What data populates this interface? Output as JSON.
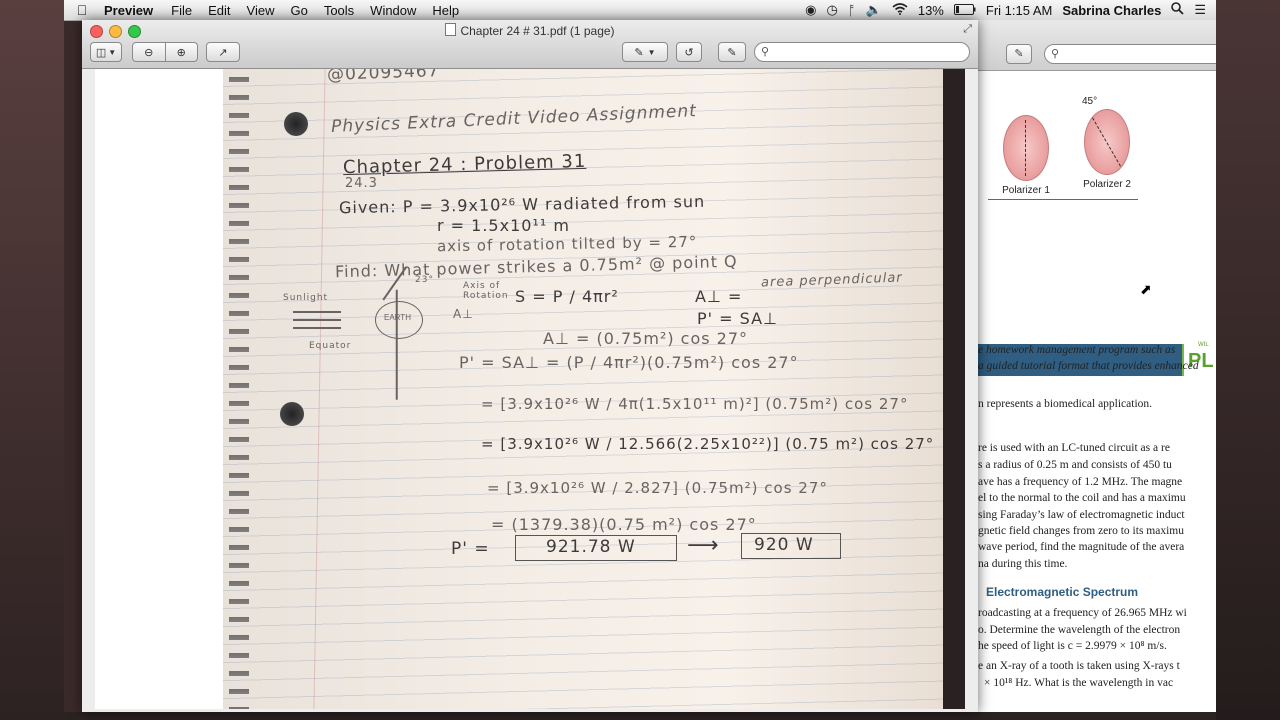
{
  "menubar": {
    "apple": "",
    "app_name": "Preview",
    "menus": [
      "File",
      "Edit",
      "View",
      "Go",
      "Tools",
      "Window",
      "Help"
    ],
    "battery": "13%",
    "clock": "Fri 1:15 AM",
    "user": "Sabrina Charles"
  },
  "window": {
    "title": "Chapter 24 # 31.pdf (1 page)",
    "search_placeholder": ""
  },
  "notes": {
    "id_line": "@02095467",
    "header": "Physics Extra Credit Video Assignment",
    "chapter": "Chapter 24 : Problem 31",
    "section": "24.3",
    "given_1": "Given: P = 3.9x10²⁶ W radiated from sun",
    "given_2": "r = 1.5x10¹¹ m",
    "given_3": "axis of rotation tilted by = 27°",
    "find": "Find: What power strikes a 0.75m² @ point Q",
    "axis_label": "Axis of Rotation",
    "sunlight_label": "Sunlight",
    "earth_label": "EARTH",
    "equator_label": "Equator",
    "angle_label": "23°",
    "area_perp": "area perpendicular",
    "s_formula": "S = P / 4πr²",
    "a_perp": "A⊥ =",
    "p_prime": "P' = SA⊥",
    "a_perp_val": "A⊥ = (0.75m²) cos 27°",
    "step1": "P' = SA⊥ = (P / 4πr²)(0.75m²) cos 27°",
    "step2": "= [3.9x10²⁶ W / 4π(1.5x10¹¹ m)²] (0.75m²) cos 27°",
    "step3": "= [3.9x10²⁶ W / 12.566(2.25x10²²)] (0.75 m²) cos 27°",
    "step4": "= [3.9x10²⁶ W / 2.827] (0.75m²) cos 27°",
    "step5": "= (1379.38)(0.75 m²) cos 27°",
    "final_label": "P' =",
    "final_value": "921.78 W",
    "arrow": "⟶",
    "rounded_value": "920 W"
  },
  "side_doc": {
    "search_placeholder": "",
    "polarizer_1": "Polarizer 1",
    "polarizer_2": "Polarizer 2",
    "angle": "45°",
    "brand_letters": "PL",
    "brand_small": "WIL",
    "lines_a": [
      "e homework management program such as",
      "a guided tutorial format that provides enhanced"
    ],
    "line_b": "n represents a biomedical application.",
    "lines_c": [
      "re is used with an LC-tuned circuit as a re",
      "s a radius of 0.25 m and consists of 450 tu",
      "ave has a frequency of 1.2 MHz. The magne",
      "el to the normal to the coil and has a maximu",
      "sing Faraday’s law of electromagnetic induct",
      "gnetic field changes from zero to its maximu",
      "wave period, find the magnitude of the avera",
      "na during this time."
    ],
    "heading": "Electromagnetic Spectrum",
    "lines_d": [
      "roadcasting at a frequency of 26.965 MHz wi",
      "o. Determine the wavelength of the electron",
      "he speed of light is c = 2.9979 × 10⁸ m/s.",
      "e an X-ray of a tooth is taken using X-rays t",
      "× 10¹⁸ Hz. What is the wavelength in vac"
    ]
  },
  "colors": {
    "banner": "#2f5e82",
    "heading": "#2f5e82",
    "close": "#fc605c",
    "minimize": "#fdbc40",
    "zoom": "#34c84a"
  }
}
